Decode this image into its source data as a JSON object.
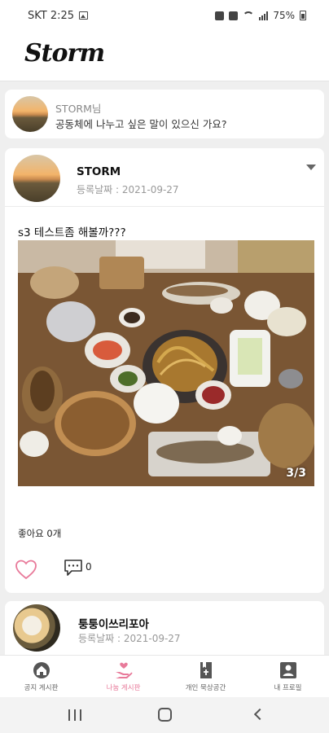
{
  "status_bar": {
    "carrier_time": "SKT 2:25",
    "battery": "75%",
    "icons": [
      "image-icon",
      "alarm-icon",
      "mute-icon",
      "wifi-icon",
      "signal-icon",
      "battery-icon"
    ]
  },
  "app": {
    "logo": "Storm"
  },
  "composer": {
    "name": "STORM님",
    "prompt": "공동체에 나누고 싶은 말이 있으신 가요?"
  },
  "posts": [
    {
      "author": "STORM",
      "date": "등록날짜 : 2021-09-27",
      "content": "s3 테스트좀 해볼까???",
      "image_counter": "3/3",
      "likes": "좋아요 0개",
      "comment_count": "0",
      "icons": [
        "dropdown-icon",
        "heart-icon",
        "comment-icon"
      ]
    },
    {
      "author": "퉁퉁이쓰리포아",
      "date": "등록날짜 : 2021-09-27"
    }
  ],
  "bottom_nav": [
    {
      "label": "공지 게시판",
      "icon": "home-icon",
      "active": false
    },
    {
      "label": "나눔 게시판",
      "icon": "share-hand-icon",
      "active": true
    },
    {
      "label": "개인 묵상공간",
      "icon": "book-icon",
      "active": false
    },
    {
      "label": "내 프로필",
      "icon": "profile-icon",
      "active": false
    }
  ],
  "colors": {
    "accent_pink": "#e87a9a",
    "icon_gray": "#555555",
    "background": "#efefef"
  }
}
